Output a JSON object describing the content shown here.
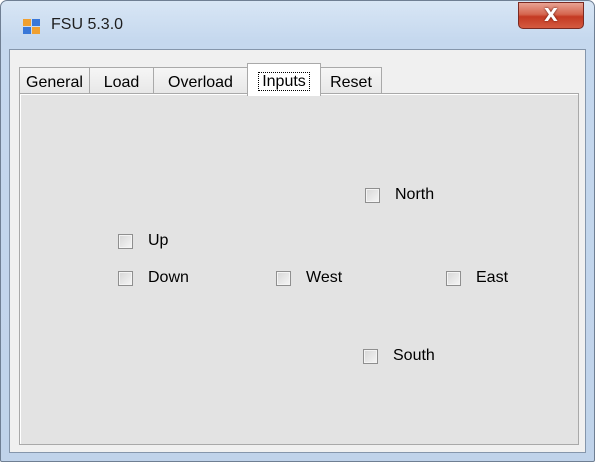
{
  "window": {
    "title": "FSU 5.3.0",
    "close_glyph": "X",
    "icon": "app-window-icon"
  },
  "tabs": [
    {
      "label": "General",
      "active": false
    },
    {
      "label": "Load",
      "active": false
    },
    {
      "label": "Overload",
      "active": false
    },
    {
      "label": "Inputs",
      "active": true
    },
    {
      "label": "Reset",
      "active": false
    }
  ],
  "inputs": {
    "north": {
      "label": "North",
      "checked": false
    },
    "up": {
      "label": "Up",
      "checked": false
    },
    "down": {
      "label": "Down",
      "checked": false
    },
    "west": {
      "label": "West",
      "checked": false
    },
    "east": {
      "label": "East",
      "checked": false
    },
    "south": {
      "label": "South",
      "checked": false
    }
  }
}
